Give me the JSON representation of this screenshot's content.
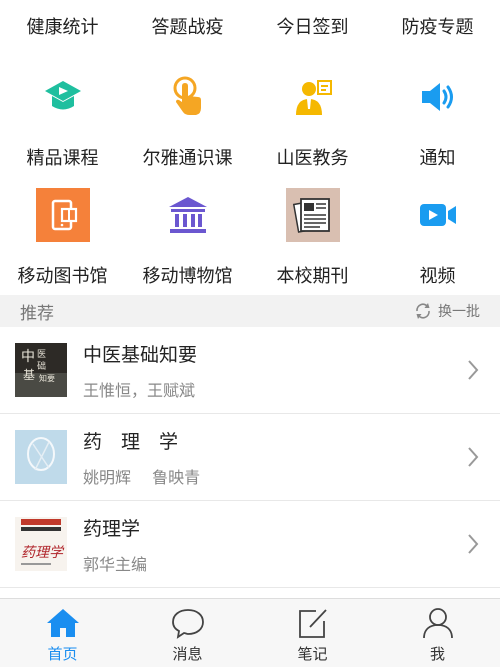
{
  "top_links": [
    {
      "label": "健康统计"
    },
    {
      "label": "答题战疫"
    },
    {
      "label": "今日签到"
    },
    {
      "label": "防疫专题"
    }
  ],
  "apps_row1": [
    {
      "label": "精品课程",
      "icon": "graduation-play-icon",
      "color": "#1fbf9f"
    },
    {
      "label": "尔雅通识课",
      "icon": "tap-hand-icon",
      "color": "#f5a623"
    },
    {
      "label": "山医教务",
      "icon": "teacher-icon",
      "color": "#f5b800"
    },
    {
      "label": "通知",
      "icon": "speaker-icon",
      "color": "#1a9cf0"
    }
  ],
  "apps_row2": [
    {
      "label": "移动图书馆",
      "icon": "mobile-library-icon",
      "color": "#f5813a"
    },
    {
      "label": "移动博物馆",
      "icon": "museum-icon",
      "color": "#6b57d0"
    },
    {
      "label": "本校期刊",
      "icon": "newspaper-icon",
      "color": "#d9bfb1"
    },
    {
      "label": "视频",
      "icon": "video-camera-icon",
      "color": "#1a9cf0"
    }
  ],
  "recommend": {
    "title": "推荐",
    "refresh_label": "换一批"
  },
  "books": [
    {
      "title": "中医基础知要",
      "authors": "王惟恒，王赋斌"
    },
    {
      "title": "药　理　学",
      "authors": "姚明辉　 鲁映青"
    },
    {
      "title": "药理学",
      "authors": "郭华主编"
    }
  ],
  "tabs": [
    {
      "label": "首页",
      "icon": "home-icon",
      "active": true
    },
    {
      "label": "消息",
      "icon": "chat-bubble-icon",
      "active": false
    },
    {
      "label": "笔记",
      "icon": "edit-note-icon",
      "active": false
    },
    {
      "label": "我",
      "icon": "person-icon",
      "active": false
    }
  ],
  "colors": {
    "accent": "#1a8ef0",
    "section_bg": "#f2f2f2",
    "secondary_text": "#888888"
  }
}
